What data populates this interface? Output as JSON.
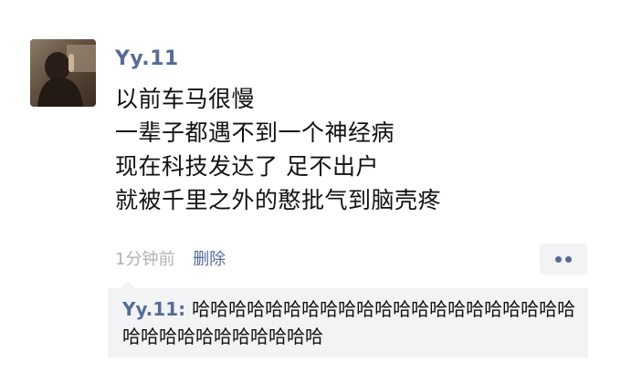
{
  "post": {
    "author": "Yy.11",
    "content_lines": [
      "以前车马很慢",
      "一辈子都遇不到一个神经病",
      "现在科技发达了 足不出户",
      "就被千里之外的憨批气到脑壳疼"
    ],
    "timestamp": "1分钟前",
    "delete_label": "删除"
  },
  "comment": {
    "author": "Yy.11",
    "separator": ": ",
    "text": "哈哈哈哈哈哈哈哈哈哈哈哈哈哈哈哈哈哈哈哈哈哈哈哈哈哈哈哈哈哈哈哈"
  },
  "colors": {
    "name_blue": "#576b95",
    "meta_gray": "#b2b2b2",
    "panel_gray": "#f3f3f5",
    "text": "#111111"
  },
  "icons": {
    "more": "more-dots-icon"
  }
}
